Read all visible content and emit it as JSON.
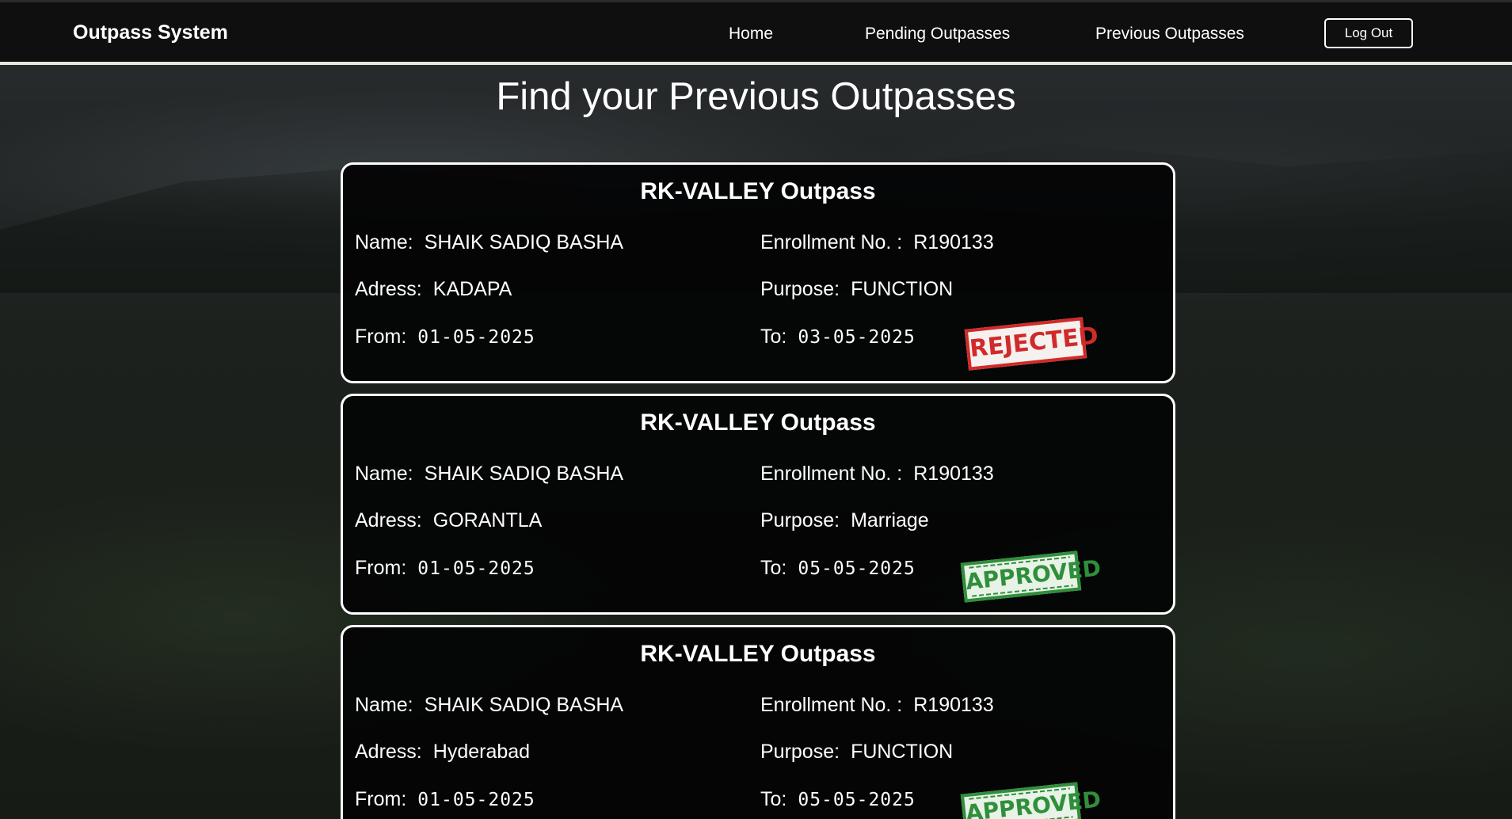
{
  "navbar": {
    "brand": "Outpass System",
    "links": {
      "home": "Home",
      "pending": "Pending Outpasses",
      "previous": "Previous Outpasses"
    },
    "logout_label": "Log Out"
  },
  "page": {
    "title": "Find your Previous Outpasses"
  },
  "labels": {
    "name": "Name:",
    "enrollment": "Enrollment No. :",
    "address": "Adress:",
    "purpose": "Purpose:",
    "from": "From:",
    "to": "To:"
  },
  "outpasses": [
    {
      "title": "RK-VALLEY Outpass",
      "name": "SHAIK SADIQ BASHA",
      "enrollment": "R190133",
      "address": "KADAPA",
      "purpose": "FUNCTION",
      "from": "01-05-2025",
      "to": "03-05-2025",
      "status": "REJECTED"
    },
    {
      "title": "RK-VALLEY Outpass",
      "name": "SHAIK SADIQ BASHA",
      "enrollment": "R190133",
      "address": "GORANTLA",
      "purpose": "Marriage",
      "from": "01-05-2025",
      "to": "05-05-2025",
      "status": "APPROVED"
    },
    {
      "title": "RK-VALLEY Outpass",
      "name": "SHAIK SADIQ BASHA",
      "enrollment": "R190133",
      "address": "Hyderabad",
      "purpose": "FUNCTION",
      "from": "01-05-2025",
      "to": "05-05-2025",
      "status": "APPROVED"
    }
  ],
  "colors": {
    "rejected": "#d12a2a",
    "approved": "#2f8f3b",
    "navbar": "#0f0f10"
  }
}
